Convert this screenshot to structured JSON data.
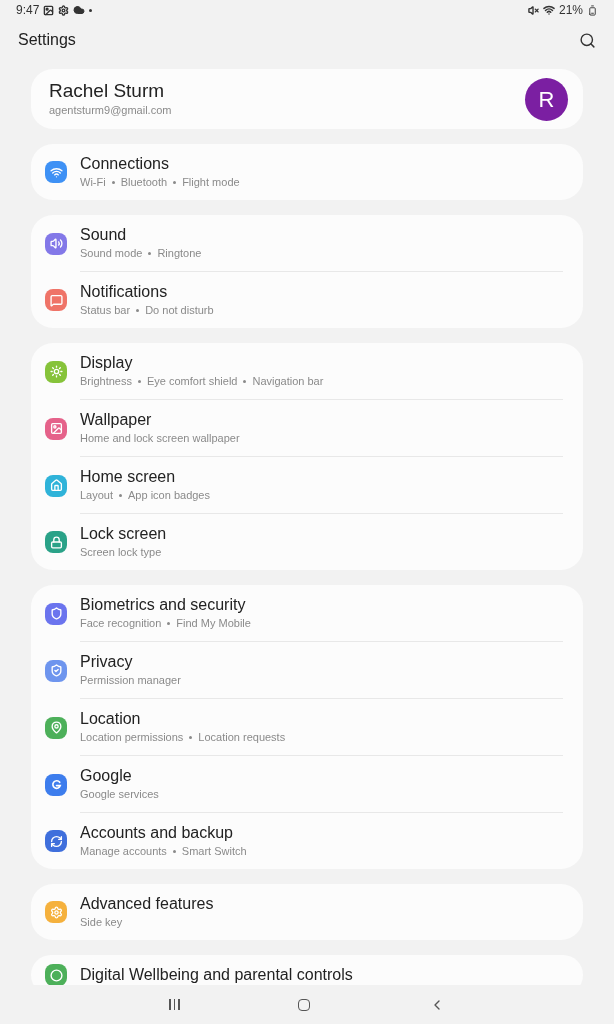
{
  "status_bar": {
    "time": "9:47",
    "battery": "21%"
  },
  "header": {
    "title": "Settings"
  },
  "profile": {
    "name": "Rachel Sturm",
    "email": "agentsturm9@gmail.com",
    "avatar_letter": "R"
  },
  "groups": [
    {
      "items": [
        {
          "title": "Connections",
          "subtitle": [
            "Wi-Fi",
            "Bluetooth",
            "Flight mode"
          ],
          "color": "#3e91f5"
        }
      ]
    },
    {
      "items": [
        {
          "title": "Sound",
          "subtitle": [
            "Sound mode",
            "Ringtone"
          ],
          "color": "#8378e8"
        },
        {
          "title": "Notifications",
          "subtitle": [
            "Status bar",
            "Do not disturb"
          ],
          "color": "#ef7468"
        }
      ]
    },
    {
      "items": [
        {
          "title": "Display",
          "subtitle": [
            "Brightness",
            "Eye comfort shield",
            "Navigation bar"
          ],
          "color": "#86c33a"
        },
        {
          "title": "Wallpaper",
          "subtitle": [
            "Home and lock screen wallpaper"
          ],
          "color": "#e5628a"
        },
        {
          "title": "Home screen",
          "subtitle": [
            "Layout",
            "App icon badges"
          ],
          "color": "#2fb3d9"
        },
        {
          "title": "Lock screen",
          "subtitle": [
            "Screen lock type"
          ],
          "color": "#2aa288"
        }
      ]
    },
    {
      "items": [
        {
          "title": "Biometrics and security",
          "subtitle": [
            "Face recognition",
            "Find My Mobile"
          ],
          "color": "#6b74ee"
        },
        {
          "title": "Privacy",
          "subtitle": [
            "Permission manager"
          ],
          "color": "#6e95ee"
        },
        {
          "title": "Location",
          "subtitle": [
            "Location permissions",
            "Location requests"
          ],
          "color": "#4db05a"
        },
        {
          "title": "Google",
          "subtitle": [
            "Google services"
          ],
          "color": "#3d7ded"
        },
        {
          "title": "Accounts and backup",
          "subtitle": [
            "Manage accounts",
            "Smart Switch"
          ],
          "color": "#3f6fdc"
        }
      ]
    },
    {
      "items": [
        {
          "title": "Advanced features",
          "subtitle": [
            "Side key"
          ],
          "color": "#f5b13d"
        }
      ]
    },
    {
      "items": [
        {
          "title": "Digital Wellbeing and parental controls",
          "color": "#4db05a"
        }
      ]
    }
  ]
}
